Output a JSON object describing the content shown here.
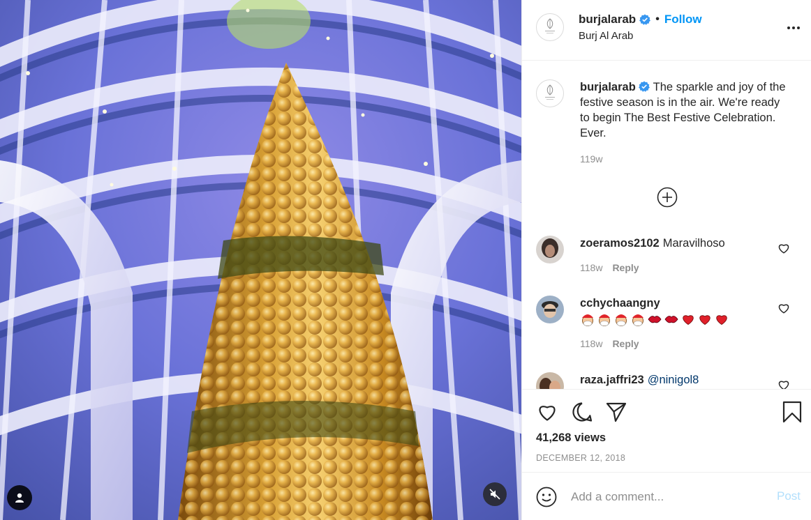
{
  "header": {
    "username": "burjalarab",
    "follow_label": "Follow",
    "separator": "•",
    "location": "Burj Al Arab"
  },
  "caption": {
    "username": "burjalarab",
    "text": "The sparkle and joy of the festive season is in the air. We're ready to begin The Best Festive Celebration. Ever.",
    "time": "119w"
  },
  "comments": [
    {
      "username": "zoeramos2102",
      "text": "Maravilhoso",
      "time": "118w",
      "reply_label": "Reply"
    },
    {
      "username": "cchychaangny",
      "text": "",
      "emojis": [
        "santa-emoji",
        "santa-emoji",
        "santa-emoji",
        "santa-emoji",
        "lips-emoji",
        "lips-emoji",
        "heart-emoji",
        "heart-emoji",
        "heart-emoji"
      ],
      "time": "118w",
      "reply_label": "Reply"
    },
    {
      "username": "raza.jaffri23",
      "text": "@ninigol8",
      "time": "",
      "reply_label": ""
    }
  ],
  "stats": {
    "views": "41,268 views",
    "date": "DECEMBER 12, 2018"
  },
  "add_comment": {
    "placeholder": "Add a comment...",
    "post_label": "Post"
  },
  "colors": {
    "accent": "#0095f6",
    "verified": "#3897f0",
    "post_disabled": "#b2dffc",
    "heart": "#ed4956",
    "muted_text": "#8e8e8e"
  },
  "icons": [
    "user-tag-icon",
    "mute-icon",
    "verified-badge-icon",
    "more-options-icon",
    "load-more-comments-icon",
    "heart-icon",
    "comment-icon",
    "share-icon",
    "bookmark-icon",
    "emoji-icon"
  ]
}
